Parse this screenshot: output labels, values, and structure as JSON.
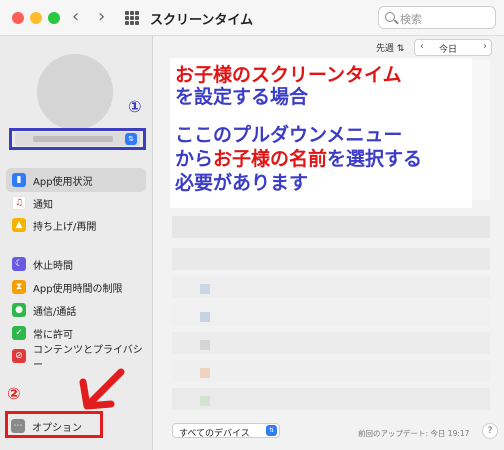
{
  "window": {
    "title": "スクリーンタイム",
    "search_placeholder": "検索"
  },
  "sidebar": {
    "items": [
      {
        "label": "App使用状況",
        "icon": "bar-chart-icon",
        "color": "#2f7cf6",
        "selected": true
      },
      {
        "label": "通知",
        "icon": "bell-icon",
        "color": "#e03a3a"
      },
      {
        "label": "持ち上げ/再開",
        "icon": "pickup-icon",
        "color": "#f5b400"
      },
      {
        "label": "休止時間",
        "icon": "moon-icon",
        "color": "#6a5ae0"
      },
      {
        "label": "App使用時間の制限",
        "icon": "hourglass-icon",
        "color": "#f5a000"
      },
      {
        "label": "通信/通話",
        "icon": "chat-icon",
        "color": "#2fb84a"
      },
      {
        "label": "常に許可",
        "icon": "checkmark-icon",
        "color": "#2fb84a"
      },
      {
        "label": "コンテンツとプライバシー",
        "icon": "block-icon",
        "color": "#e03a3a"
      }
    ],
    "options_label": "オプション"
  },
  "main": {
    "week_selector": "先週",
    "today_label": "今日",
    "device_selector": "すべてのデバイス",
    "last_update": "前回のアップデート: 今日 19:17",
    "help": "?"
  },
  "annotation": {
    "line1": "お子様のスクリーンタイム",
    "line2": "を設定する場合",
    "line3a": "ここのプルダウンメニュー",
    "line4a": "から",
    "line4b": "お子様の名前",
    "line4c": "を選択する",
    "line5": "必要があります",
    "marker1": "①",
    "marker2": "②",
    "color_red": "#e01515",
    "color_blue": "#3c3cc6"
  }
}
